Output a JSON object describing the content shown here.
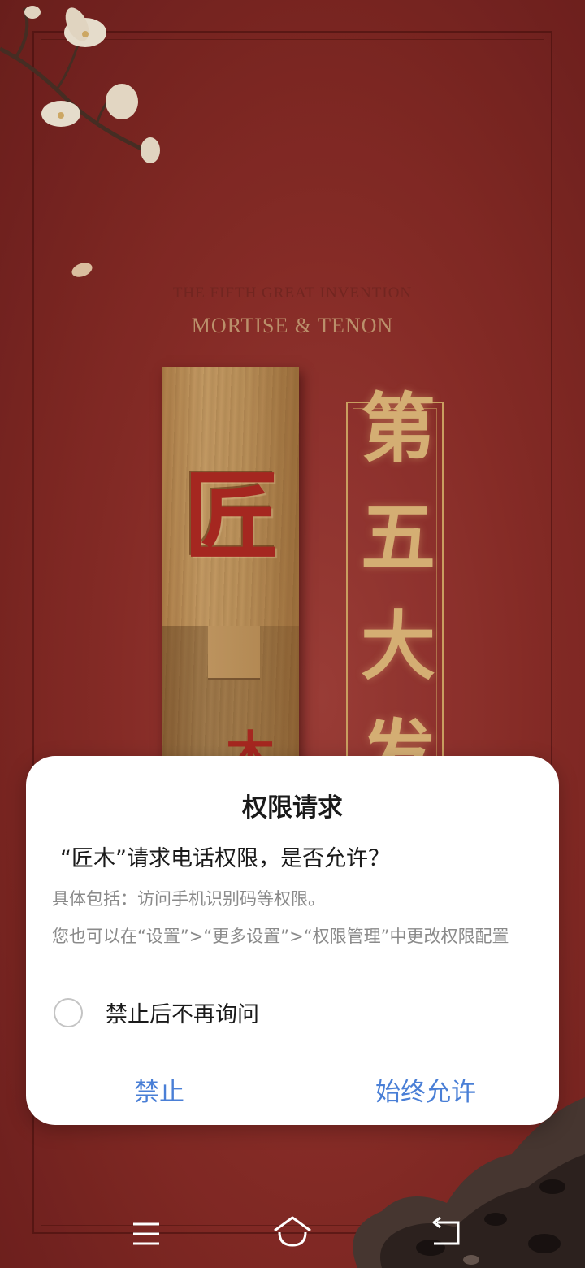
{
  "background": {
    "subtitle_small": "THE FIFTH GREAT INVENTION",
    "subtitle_large": "MORTISE & TENON",
    "carved_character": "匠",
    "carved_character_partial": "木",
    "gold_vertical_text": "第\n五\n大\n发"
  },
  "dialog": {
    "title": "权限请求",
    "question": "“匠木”请求电话权限，是否允许？",
    "detail": "具体包括：访问手机识别码等权限。",
    "hint": "您也可以在“设置”>“更多设置”>“权限管理”中更改权限配置",
    "checkbox_label": "禁止后不再询问",
    "deny_label": "禁止",
    "allow_label": "始终允许"
  },
  "navbar": {
    "icons": [
      "menu-icon",
      "home-icon",
      "back-icon"
    ]
  },
  "colors": {
    "background_red": "#8e2e29",
    "gold": "#e2b97b",
    "button_blue": "#4a7fd6",
    "dialog_bg": "#ffffff"
  }
}
